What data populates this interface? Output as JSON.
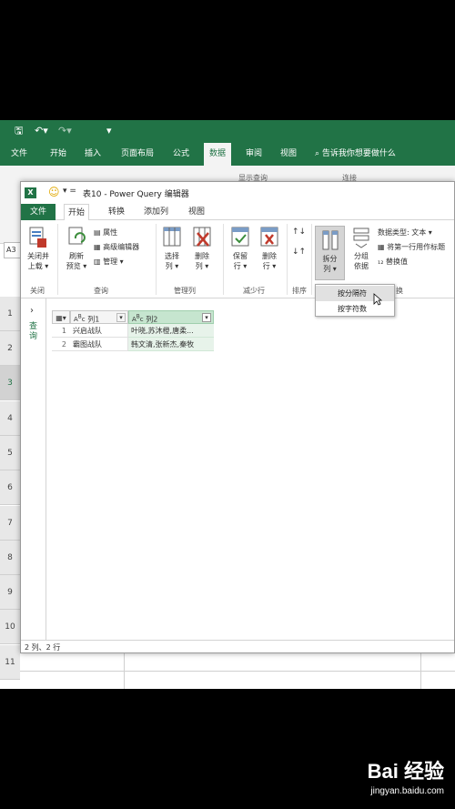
{
  "excel": {
    "tabs": [
      "文件",
      "开始",
      "插入",
      "页面布局",
      "公式",
      "数据",
      "审阅",
      "视图"
    ],
    "active_tab": "数据",
    "tell_me": "告诉我你想要做什么",
    "name_box": "A3",
    "row_numbers": [
      "1",
      "2",
      "3",
      "4",
      "5",
      "6",
      "7",
      "8",
      "9",
      "10",
      "11"
    ],
    "ribbon_partial": {
      "show_query": "显示查询",
      "connections": "连接"
    }
  },
  "pq": {
    "title": "表10 - Power Query 编辑器",
    "tabs": [
      "文件",
      "开始",
      "转换",
      "添加列",
      "视图"
    ],
    "active_tab": "开始",
    "ribbon": {
      "close_load": "关闭并\n上载",
      "close_load_l1": "关闭并",
      "close_load_l2": "上载",
      "refresh_l1": "刷新",
      "refresh_l2": "预览",
      "properties": "属性",
      "advanced_editor": "高级编辑器",
      "manage": "管理",
      "choose_cols_l1": "选择",
      "choose_cols_l2": "列",
      "remove_cols_l1": "删除",
      "remove_cols_l2": "列",
      "keep_rows_l1": "保留",
      "keep_rows_l2": "行",
      "remove_rows_l1": "删除",
      "remove_rows_l2": "行",
      "split_col_l1": "拆分",
      "split_col_l2": "列",
      "group_by_l1": "分组",
      "group_by_l2": "依据",
      "data_type": "数据类型: 文本",
      "first_row_header": "将第一行用作标题",
      "replace_values": "替换值",
      "groups": {
        "close": "关闭",
        "query": "查询",
        "manage_cols": "管理列",
        "reduce_rows": "减少行",
        "sort": "排序",
        "transform_tail": "换"
      }
    },
    "dropdown": [
      "按分隔符",
      "按字符数"
    ],
    "left_pane_label": "查询",
    "table": {
      "headers": [
        "列1",
        "列2"
      ],
      "rows": [
        {
          "n": "1",
          "c1": "兴启战队",
          "c2": "叶晓,苏沐橙,唐柔..."
        },
        {
          "n": "2",
          "c1": "霸图战队",
          "c2": "韩文清,张新杰,秦牧"
        }
      ]
    },
    "status": "2 列、2 行"
  },
  "watermark": {
    "brand": "Bai 经验",
    "url": "jingyan.baidu.com"
  },
  "colors": {
    "excel_green": "#217346",
    "highlight": "#d5d5d5"
  }
}
